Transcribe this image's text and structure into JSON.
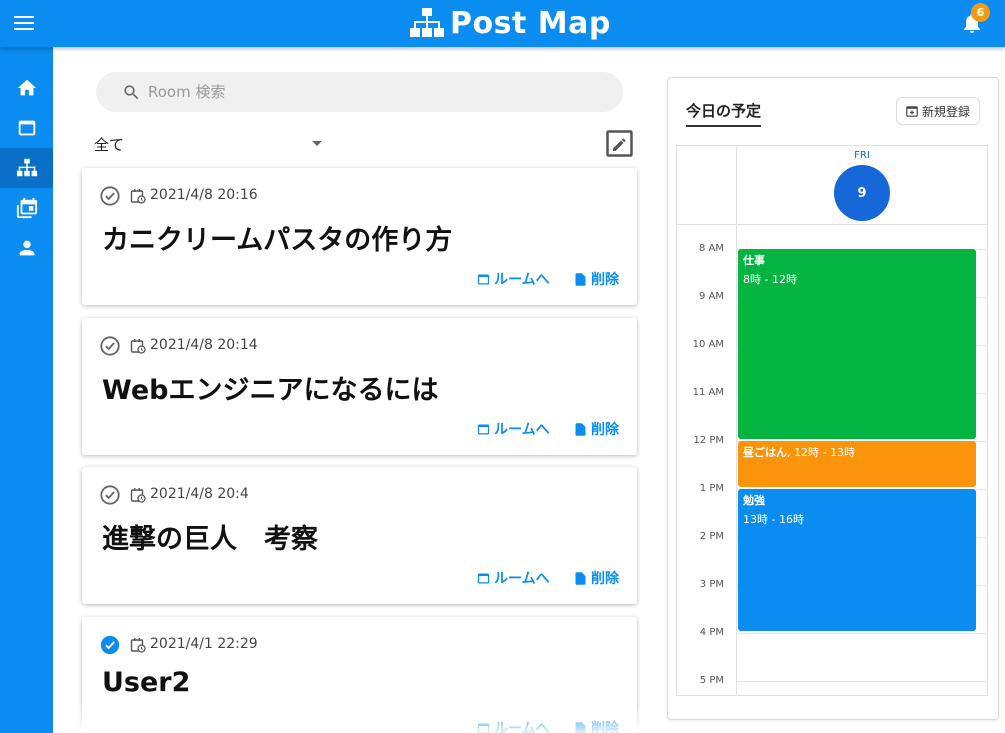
{
  "app": {
    "title": "Post Map",
    "notification_count": "6"
  },
  "sidebar": {
    "items": [
      {
        "icon": "home-icon"
      },
      {
        "icon": "window-icon"
      },
      {
        "icon": "sitemap-icon",
        "active": true
      },
      {
        "icon": "calendar-multiple-icon"
      },
      {
        "icon": "account-icon"
      }
    ]
  },
  "search": {
    "placeholder": "Room 検索",
    "value": ""
  },
  "filter": {
    "selected": "全て"
  },
  "posts": [
    {
      "date": "2021/4/8 20:16",
      "title": "カニクリームパスタの作り方",
      "checked": false,
      "room_label": "ルームへ",
      "delete_label": "削除"
    },
    {
      "date": "2021/4/8 20:14",
      "title": "Webエンジニアになるには",
      "checked": false,
      "room_label": "ルームへ",
      "delete_label": "削除"
    },
    {
      "date": "2021/4/8 20:4",
      "title": "進撃の巨人　考察",
      "checked": false,
      "room_label": "ルームへ",
      "delete_label": "削除"
    },
    {
      "date": "2021/4/1 22:29",
      "title": "User2",
      "checked": true,
      "room_label": "ルームへ",
      "delete_label": "削除"
    }
  ],
  "schedule": {
    "title": "今日の予定",
    "new_button": "新規登録",
    "day_of_week": "FRI",
    "day_number": "9",
    "hours": [
      "8 AM",
      "9 AM",
      "10 AM",
      "11 AM",
      "12 PM",
      "1 PM",
      "2 PM",
      "3 PM",
      "4 PM",
      "5 PM"
    ],
    "events": [
      {
        "name": "仕事",
        "time": "8時 - 12時",
        "color": "#03b441"
      },
      {
        "name": "昼ごはん",
        "time": "12時 - 13時",
        "color": "#fb930b"
      },
      {
        "name": "勉強",
        "time": "13時 - 16時",
        "color": "#0a8cf0"
      }
    ]
  },
  "colors": {
    "primary": "#0a8cf0",
    "badge": "#f59b12",
    "today": "#1668d8"
  }
}
